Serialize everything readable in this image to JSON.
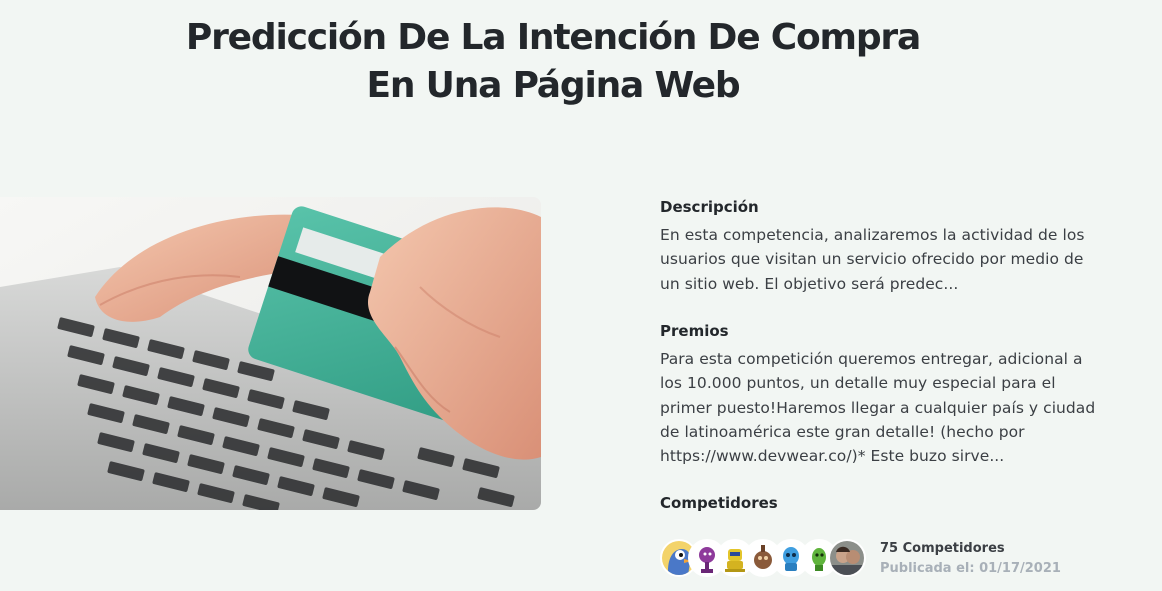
{
  "competition": {
    "title_line1": "Predicción De La Intención De Compra",
    "title_line2": "En Una Página Web"
  },
  "description": {
    "heading": "Descripción",
    "text": "En esta competencia, analizaremos la actividad de los usuarios que visitan un servicio ofrecido por medio de un sitio web.  El objetivo será predec..."
  },
  "prizes": {
    "heading": "Premios",
    "text": "Para esta competición queremos entregar, adicional a los 10.000 puntos, un detalle muy especial para el primer puesto!Haremos llegar a cualquier país y ciudad de latinoamérica este gran detalle! (hecho por https://www.devwear.co/)* Este buzo sirve..."
  },
  "competitors": {
    "heading": "Competidores",
    "count_label": "75 Competidores",
    "published_label": "Publicada el: 01/17/2021",
    "avatars": [
      {
        "name": "cartoon-bird-avatar"
      },
      {
        "name": "purple-robot-avatar"
      },
      {
        "name": "yellow-robot-avatar"
      },
      {
        "name": "brown-robot-avatar"
      },
      {
        "name": "blue-robot-avatar"
      },
      {
        "name": "green-robot-avatar"
      },
      {
        "name": "photo-avatar"
      }
    ]
  },
  "colors": {
    "background": "#f2f6f3",
    "card": "#3fae95",
    "text": "#3b3f44",
    "muted": "#a8b0b8"
  }
}
